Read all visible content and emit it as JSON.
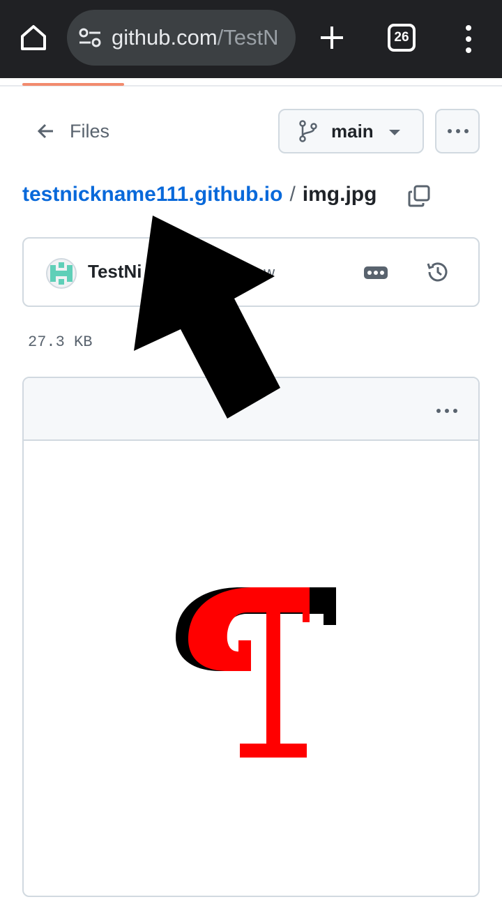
{
  "browser": {
    "url_host": "github.com",
    "url_path": "/TestN",
    "tab_count": "26"
  },
  "header": {
    "back_label": "Files",
    "branch": "main"
  },
  "breadcrumb": {
    "repo": "testnickname111.github.io",
    "separator": "/",
    "file": "img.jpg"
  },
  "commit": {
    "author": "TestNi",
    "time": "ow"
  },
  "file": {
    "size": "27.3 KB",
    "preview_glyph": "T"
  },
  "colors": {
    "link": "#0969da",
    "chrome_bg": "#202124",
    "progress": "#f28b6e",
    "glyph_fill": "#ff0000",
    "glyph_shadow": "#000000"
  },
  "icons": [
    "home-icon",
    "tune-icon",
    "plus-icon",
    "tabs-icon",
    "kebab-menu-icon",
    "arrow-left-icon",
    "git-branch-icon",
    "caret-down-icon",
    "kebab-horizontal-icon",
    "copy-icon",
    "history-icon",
    "pointer-arrow"
  ]
}
